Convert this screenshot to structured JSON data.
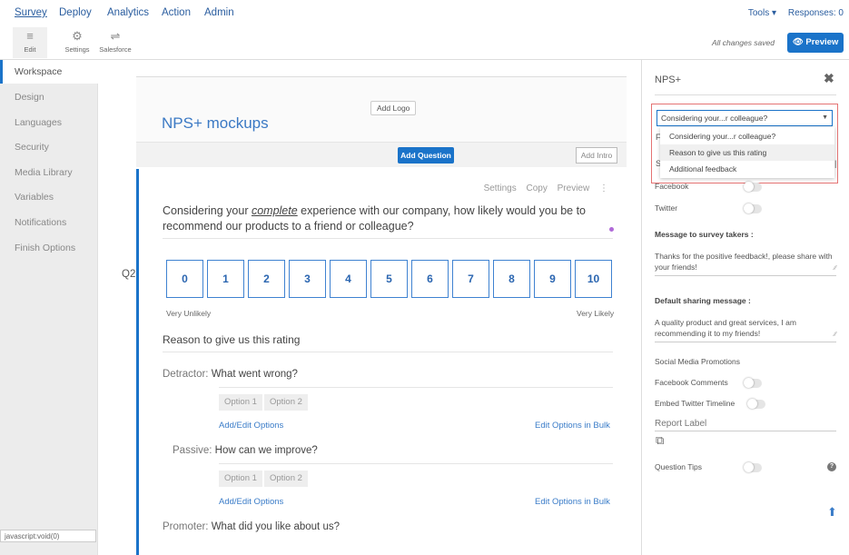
{
  "topnav": {
    "items": [
      "Survey",
      "Deploy",
      "Analytics",
      "Action",
      "Admin"
    ],
    "tools": "Tools ▾",
    "responses": "Responses: 0"
  },
  "toolbar": {
    "edit": "Edit",
    "settings": "Settings",
    "salesforce": "Salesforce",
    "saved": "All changes saved",
    "preview": "👁 Preview"
  },
  "sidebar": {
    "items": [
      "Workspace",
      "Design",
      "Languages",
      "Security",
      "Media Library",
      "Variables",
      "Notifications",
      "Finish Options"
    ]
  },
  "statusbar": "javascript:void(0)",
  "main": {
    "add_logo": "Add Logo",
    "survey_title": "NPS+ mockups",
    "add_question": "Add Question",
    "add_intro": "Add Intro",
    "qnum": "Q2",
    "actions": [
      "Settings",
      "Copy",
      "Preview",
      "⋮"
    ],
    "question_pre": "Considering your ",
    "question_emph": "complete",
    "question_post": " experience with our company, how likely would you be to recommend our products to a friend or colleague?",
    "scale": [
      "0",
      "1",
      "2",
      "3",
      "4",
      "5",
      "6",
      "7",
      "8",
      "9",
      "10"
    ],
    "scale_low": "Very Unlikely",
    "scale_high": "Very Likely",
    "reason_label": "Reason to give us this rating",
    "detractor_label": "Detractor:",
    "detractor_question": "What went wrong?",
    "passive_label": "Passive:",
    "passive_question": "How can we improve?",
    "promoter_label": "Promoter:",
    "promoter_question": "What did you like about us?",
    "option1": "Option 1",
    "option2": "Option 2",
    "add_edit": "Add/Edit Options",
    "edit_bulk": "Edit Options in Bulk"
  },
  "panel": {
    "title": "NPS+",
    "close": "✖",
    "dropdown_selected": "Considering your...r colleague?",
    "dropdown_options": [
      "Considering your...r colleague?",
      "Reason to give us this rating",
      "Additional feedback"
    ],
    "facebook": "Facebook",
    "twitter": "Twitter",
    "message_label": "Message to survey takers :",
    "message_text": "Thanks for the positive feedback!, please share with your friends!",
    "default_label": "Default sharing message :",
    "default_text": "A quality product and great services, I am recommending it to my friends!",
    "social_promotions": "Social Media Promotions",
    "facebook_comments": "Facebook Comments",
    "embed_twitter": "Embed Twitter Timeline",
    "report_label": "Report Label",
    "question_tips": "Question Tips",
    "help": "?",
    "scroll_up": "⬆"
  },
  "colors": {
    "accent": "#1a73c9",
    "highlight": "#e57373"
  }
}
